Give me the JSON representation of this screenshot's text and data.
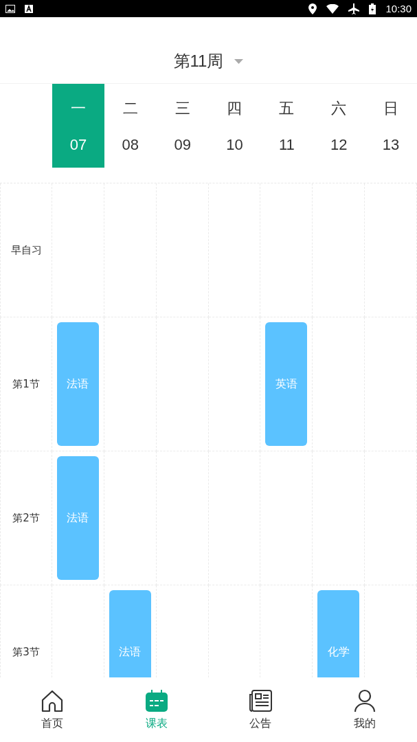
{
  "status_bar": {
    "time": "10:30"
  },
  "week_title": "第11周",
  "days": [
    {
      "weekday": "一",
      "date": "07",
      "selected": true
    },
    {
      "weekday": "二",
      "date": "08",
      "selected": false
    },
    {
      "weekday": "三",
      "date": "09",
      "selected": false
    },
    {
      "weekday": "四",
      "date": "10",
      "selected": false
    },
    {
      "weekday": "五",
      "date": "11",
      "selected": false
    },
    {
      "weekday": "六",
      "date": "12",
      "selected": false
    },
    {
      "weekday": "日",
      "date": "13",
      "selected": false
    }
  ],
  "periods": [
    {
      "label": "早自习",
      "cells": [
        null,
        null,
        null,
        null,
        null,
        null,
        null
      ]
    },
    {
      "label": "第1节",
      "cells": [
        "法语",
        null,
        null,
        null,
        "英语",
        null,
        null
      ]
    },
    {
      "label": "第2节",
      "cells": [
        "法语",
        null,
        null,
        null,
        null,
        null,
        null
      ]
    },
    {
      "label": "第3节",
      "cells": [
        null,
        "法语",
        null,
        null,
        null,
        "化学",
        null
      ]
    }
  ],
  "nav": [
    {
      "kind": "home",
      "label": "首页",
      "selected": false
    },
    {
      "kind": "calendar",
      "label": "课表",
      "selected": true
    },
    {
      "kind": "news",
      "label": "公告",
      "selected": false
    },
    {
      "kind": "person",
      "label": "我的",
      "selected": false
    }
  ]
}
